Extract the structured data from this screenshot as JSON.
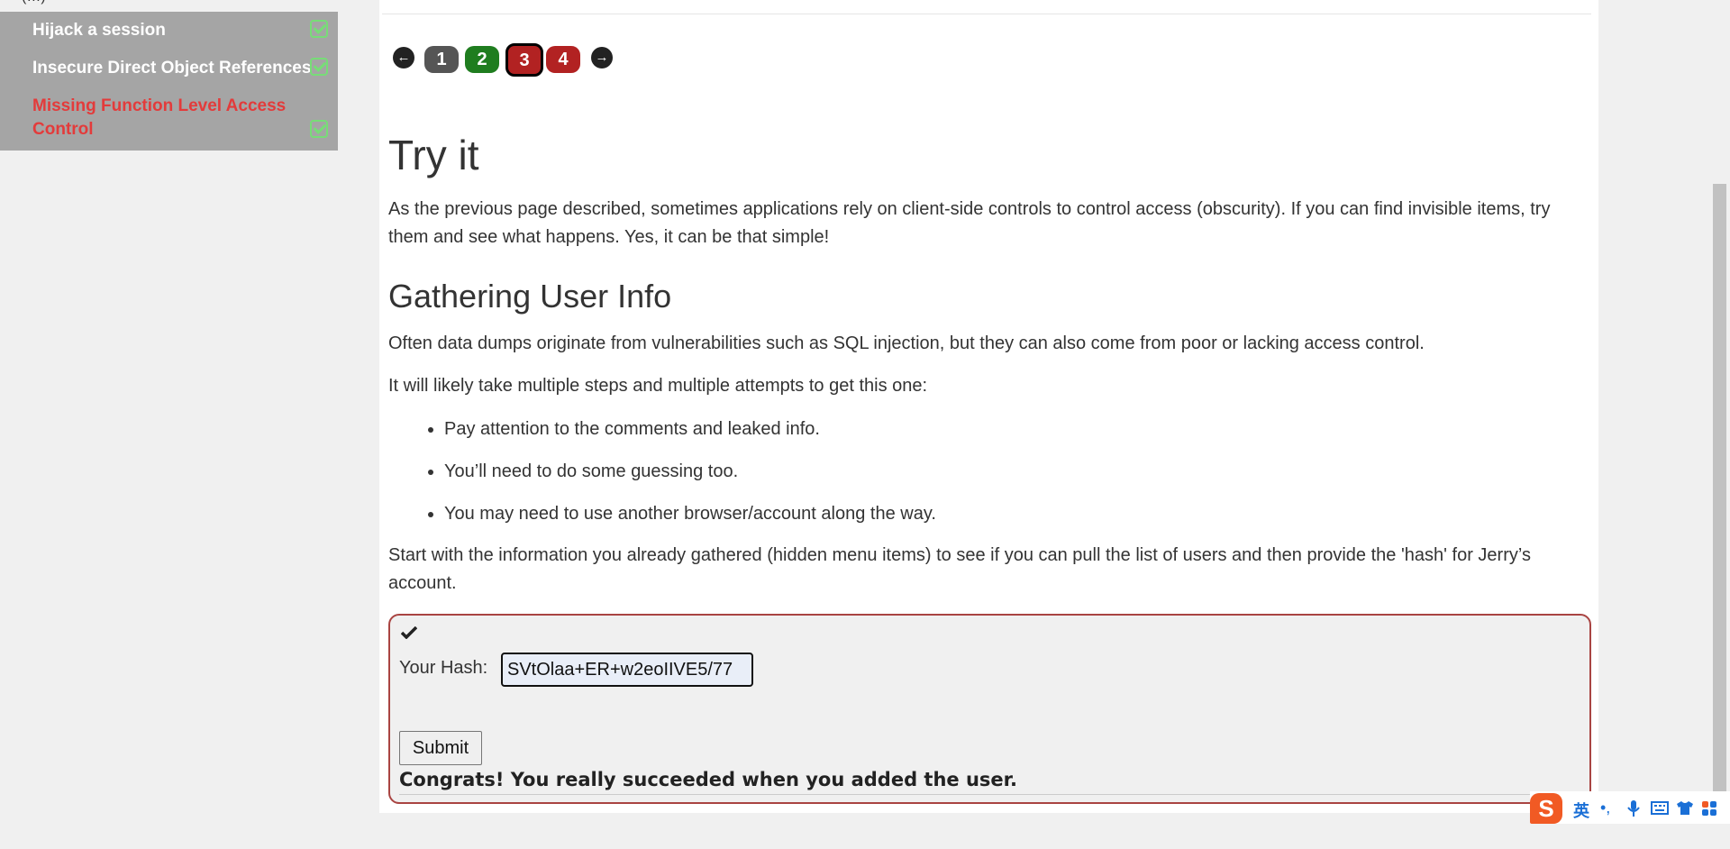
{
  "sidebar": {
    "top_fragment": "(…)",
    "items": [
      {
        "label": "Hijack a session",
        "completed": true,
        "active": false
      },
      {
        "label": "Insecure Direct Object References",
        "completed": true,
        "active": false
      },
      {
        "label": "Missing Function Level Access Control",
        "label_line1": "Missing Function Level Access",
        "label_line2": "Control",
        "completed": true,
        "active": true
      }
    ]
  },
  "pagination": {
    "prev_icon": "arrow-left-icon",
    "next_icon": "arrow-right-icon",
    "pages": [
      {
        "label": "1",
        "color": "#555555"
      },
      {
        "label": "2",
        "color": "#1f7d1f"
      },
      {
        "label": "3",
        "color": "#b22222",
        "current": true
      },
      {
        "label": "4",
        "color": "#b22222"
      }
    ]
  },
  "content": {
    "title": "Try it",
    "intro": "As the previous page described, sometimes applications rely on client-side controls to control access (obscurity). If you can find invisible items, try them and see what happens. Yes, it can be that simple!",
    "subtitle": "Gathering User Info",
    "para1": "Often data dumps originate from vulnerabilities such as SQL injection, but they can also come from poor or lacking access control.",
    "para2": "It will likely take multiple steps and multiple attempts to get this one:",
    "bullets": [
      "Pay attention to the comments and leaked info.",
      "You’ll need to do some guessing too.",
      "You may need to use another browser/account along the way."
    ],
    "para3": "Start with the information you already gathered (hidden menu items) to see if you can pull the list of users and then provide the 'hash' for Jerry’s account."
  },
  "form": {
    "status_icon": "checkmark-icon",
    "hash_label": "Your Hash:",
    "hash_value": "SVtOlaa+ER+w2eoIIVE5/77",
    "submit_label": "Submit",
    "feedback": "Congrats! You really succeeded when you added the user."
  },
  "ime_toolbar": {
    "logo": "S",
    "lang": "英",
    "punct": "•,",
    "icons": [
      "microphone-icon",
      "keyboard-icon",
      "shirt-icon",
      "apps-icon"
    ]
  },
  "colors": {
    "sidebar_panel": "#a5a5a5",
    "active_item": "#e33b3b",
    "check": "#77dd77",
    "form_border": "#a94442"
  }
}
